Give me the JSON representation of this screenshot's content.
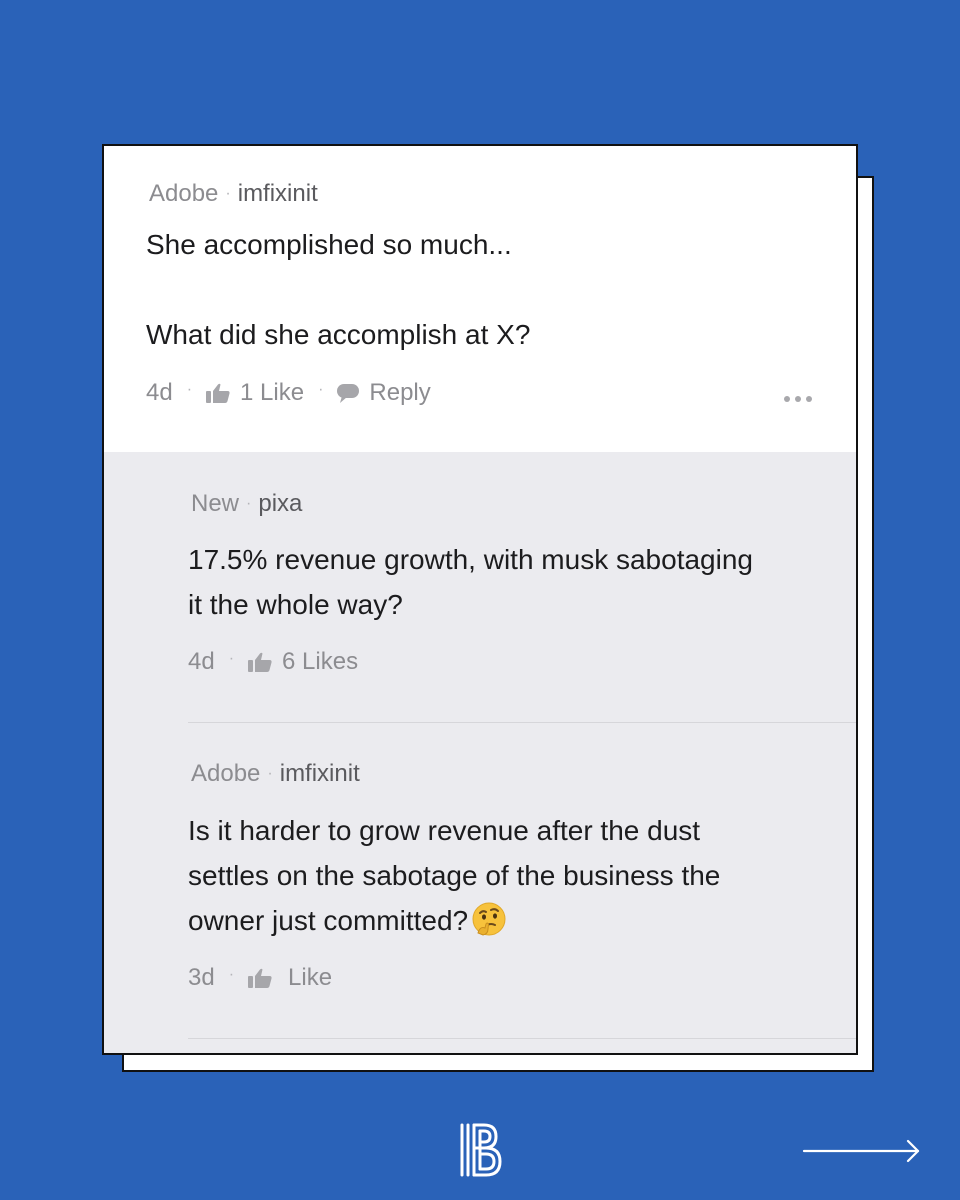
{
  "comments": [
    {
      "company": "Adobe",
      "username": "imfixinit",
      "text_lines": [
        "She accomplished so much...",
        "What did she accomplish at X?"
      ],
      "age": "4d",
      "likes": "1 Like",
      "reply_label": "Reply"
    },
    {
      "company": "New",
      "username": "pixa",
      "text_lines": [
        "17.5% revenue growth, with musk sabotaging",
        "it the whole way?"
      ],
      "age": "4d",
      "likes": "6 Likes"
    },
    {
      "company": "Adobe",
      "username": "imfixinit",
      "text_lines": [
        "Is it harder to grow revenue after the dust",
        "settles on the sabotage of the business the",
        "owner just committed?"
      ],
      "age": "3d",
      "likes": "Like"
    }
  ],
  "separator": "·",
  "icons": {
    "like": "thumbs-up-icon",
    "reply": "speech-bubble-icon",
    "more": "more-options-icon",
    "emoji": "thinking-face-emoji",
    "logo": "brand-b-logo",
    "next": "arrow-right-icon"
  },
  "colors": {
    "background": "#2a62b8",
    "card": "#ffffff",
    "reply_background": "#ebebef",
    "text": "#1c1c1e",
    "muted": "#8c8c90"
  }
}
